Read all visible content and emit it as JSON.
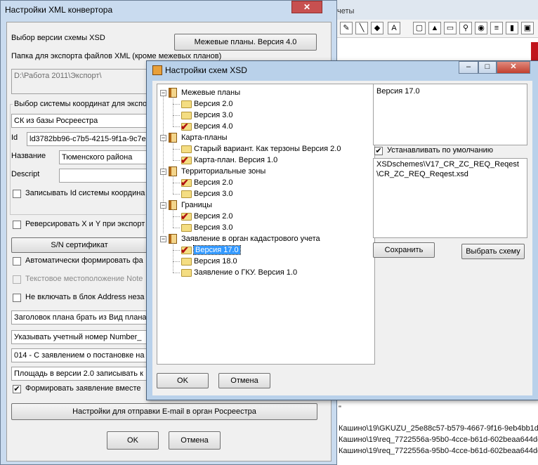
{
  "background_window": {
    "menu_text": "четы",
    "lines": [
      "Кашино\\19\\GKUZU_25e88c57-b579-4667-9f16-9eb4bb1d",
      "Кашино\\19\\req_7722556a-95b0-4cce-b61d-602beaa644dc",
      "Кашино\\19\\req_7722556a-95b0-4cce-b61d-602beaa644dc"
    ],
    "quote_mark": "\""
  },
  "main_window": {
    "title": "Настройки XML конвертора",
    "close_glyph": "✕",
    "xsd_version_label": "Выбор версии схемы XSD",
    "xsd_version_button": "Межевые планы. Версия 4.0",
    "export_folder_label": "Папка для экспорта файлов XML (кроме межевых планов)",
    "export_folder_value": "D:\\Работа 2011\\Экспорт\\",
    "coord_group_label": "Выбор системы координат для экспо",
    "coord_select_value": "СК из базы Росреестра",
    "id_label": "Id",
    "id_value": "ld3782bb96-c7b5-4215-9f1a-9c7e",
    "name_label": "Название",
    "name_value": "Тюменского района",
    "descript_label": "Descript",
    "descript_value": "",
    "write_id_label": "Записывать Id системы координа",
    "reverse_xy_label": "Реверсировать X и Y при экспорт",
    "sn_cert_button": "S/N сертификат",
    "auto_form_label": "Автоматически формировать фа",
    "text_loc_label": "Текстовое местоположение Note",
    "address_label": "Не включать в блок Address неза",
    "plan_header_value": "Заголовок плана брать из Вид плана",
    "number_value": "Указывать учетный номер Number_",
    "statement_value": "014 - С заявлением о постановке на",
    "area_value": "Площадь в версии 2.0 записывать к",
    "form_statement_label": "Формировать заявление вместе",
    "email_button": "Настройки для отправки E-mail в орган Росреестра",
    "ok_button": "OK",
    "cancel_button": "Отмена"
  },
  "dialog": {
    "title": "Настройки схем XSD",
    "minimize_glyph": "–",
    "maximize_glyph": "□",
    "close_glyph": "✕",
    "tree": [
      {
        "label": "Межевые планы",
        "children": [
          {
            "label": "Версия 2.0",
            "checked": false
          },
          {
            "label": "Версия 3.0",
            "checked": false
          },
          {
            "label": "Версия 4.0",
            "checked": true
          }
        ]
      },
      {
        "label": "Карта-планы",
        "children": [
          {
            "label": "Старый вариант. Как терзоны Версия 2.0",
            "checked": false
          },
          {
            "label": "Карта-план. Версия 1.0",
            "checked": true
          }
        ]
      },
      {
        "label": "Территориальные зоны",
        "children": [
          {
            "label": "Версия 2.0",
            "checked": true
          },
          {
            "label": "Версия 3.0",
            "checked": false
          }
        ]
      },
      {
        "label": "Границы",
        "children": [
          {
            "label": "Версия 2.0",
            "checked": true
          },
          {
            "label": "Версия 3.0",
            "checked": false
          }
        ]
      },
      {
        "label": "Заявление в орган кадастрового учета",
        "children": [
          {
            "label": "Версия 17.0",
            "checked": true,
            "selected": true
          },
          {
            "label": "Версия 18.0",
            "checked": false
          },
          {
            "label": "Заявление о ГКУ. Версия 1.0",
            "checked": false
          }
        ]
      }
    ],
    "version_text": "Версия 17.0",
    "default_checkbox_label": "Устанавливать по умолчанию",
    "default_checked": true,
    "schema_path_line1": "XSDschemes\\V17_CR_ZC_REQ_Reqest",
    "schema_path_line2": "\\CR_ZC_REQ_Reqest.xsd",
    "save_button": "Сохранить",
    "choose_schema_button": "Выбрать схему",
    "ok_button": "OK",
    "cancel_button": "Отмена"
  }
}
